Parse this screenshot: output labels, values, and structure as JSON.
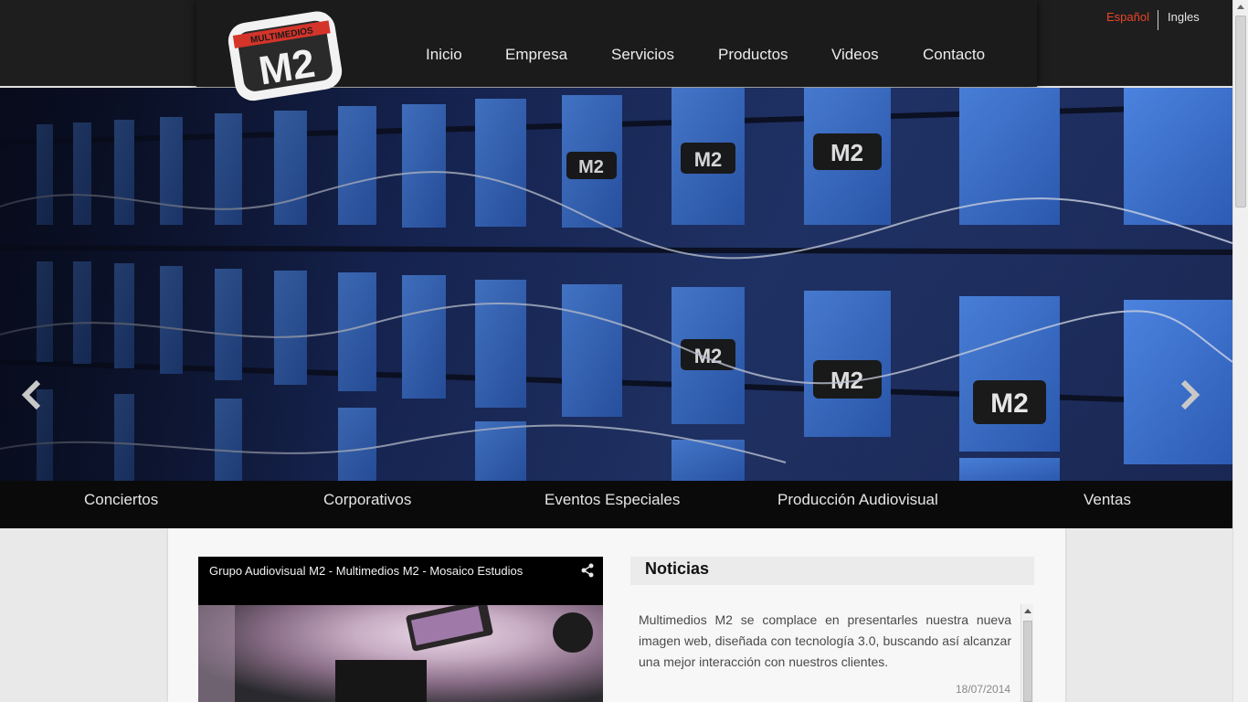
{
  "header": {
    "logo": {
      "top_text": "MULTIMEDIOS",
      "mark": "M2"
    },
    "nav": [
      "Inicio",
      "Empresa",
      "Servicios",
      "Productos",
      "Videos",
      "Contacto"
    ],
    "languages": {
      "spanish": "Español",
      "english": "Ingles"
    }
  },
  "slider": {
    "tiles": [
      "M2",
      "M2",
      "M2",
      "M2",
      "M2",
      "M2"
    ],
    "prev_icon": "chevron-left-icon",
    "next_icon": "chevron-right-icon"
  },
  "categories": [
    "Conciertos",
    "Corporativos",
    "Eventos Especiales",
    "Producción Audiovisual",
    "Ventas"
  ],
  "video": {
    "title": "Grupo Audiovisual M2 - Multimedios M2 - Mosaico Estudios",
    "icon": "share-icon"
  },
  "news": {
    "heading": "Noticias",
    "items": [
      {
        "text": "Multimedios M2 se complace en presentarles nuestra nueva imagen web, diseñada con tecnología 3.0, buscando así alcanzar una mejor interacción con nuestros clientes.",
        "date": "18/07/2014"
      }
    ]
  },
  "colors": {
    "accent": "#e8452a",
    "header_bg": "#1e1e1e",
    "panel_blue": "#3a6fd0"
  }
}
